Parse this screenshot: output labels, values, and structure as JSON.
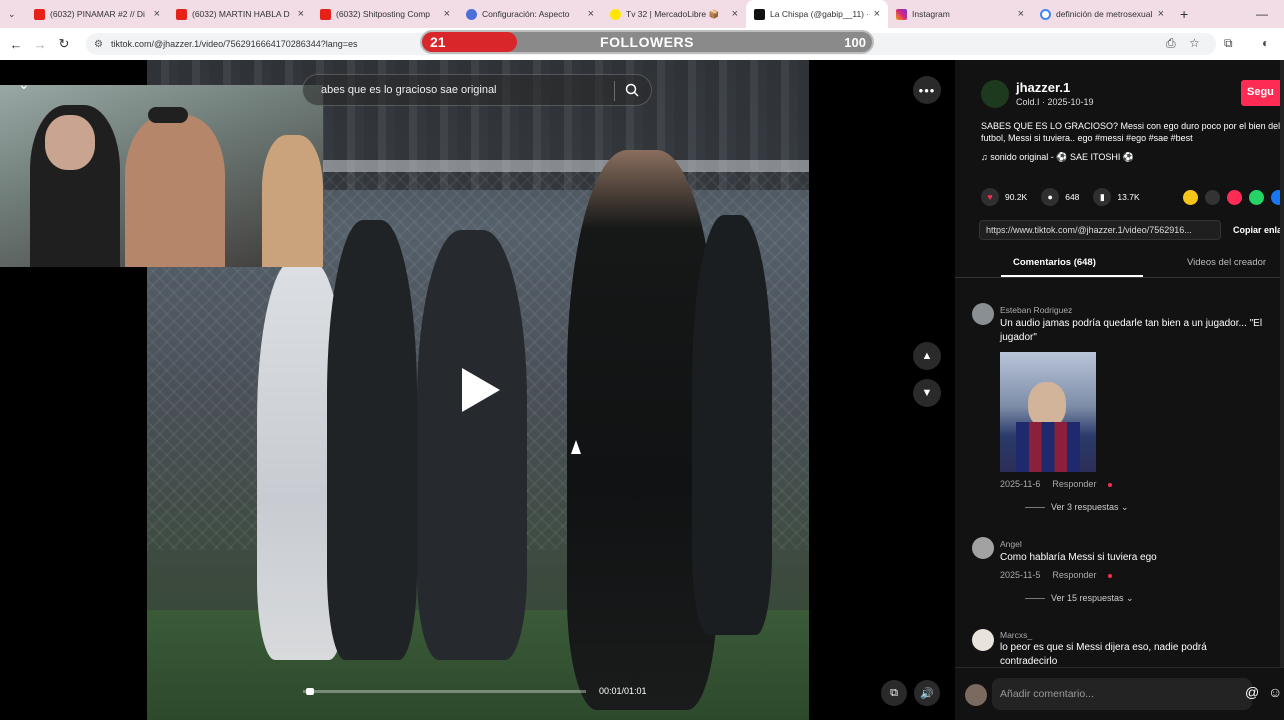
{
  "browser": {
    "tabs": [
      {
        "label": "(6032) PINAMAR #2 // Di",
        "favicon": "youtube",
        "active": false
      },
      {
        "label": "(6032) MARTIN HABLA D",
        "favicon": "youtube",
        "active": false
      },
      {
        "label": "(6032) Shitposting Comp",
        "favicon": "youtube",
        "active": false
      },
      {
        "label": "Configuración: Aspecto",
        "favicon": "gear",
        "active": false
      },
      {
        "label": "Tv 32 | MercadoLibre 📦",
        "favicon": "mercadolibre",
        "active": false
      },
      {
        "label": "La Chispa (@gabip__11) ·",
        "favicon": "tiktok",
        "active": true
      },
      {
        "label": "Instagram",
        "favicon": "instagram",
        "active": false
      },
      {
        "label": "definición de metrosexual",
        "favicon": "google",
        "active": false
      }
    ],
    "url": "tiktok.com/@jhazzer.1/video/7562916664170286344?lang=es"
  },
  "overlay": {
    "followers_label": "FOLLOWERS",
    "current": "21",
    "goal": "100",
    "progress_fraction": 0.21
  },
  "video": {
    "search_text": "abes que es lo gracioso sae original",
    "time": "00:01/01:01",
    "progress_fraction": 0.01
  },
  "creator": {
    "username": "jhazzer.1",
    "subline": "Cold.I · 2025-10-19",
    "follow_label": "Segu",
    "description": "SABES QUE ES LO GRACIOSO? Messi con ego duro poco por el bien del futbol, Messi si tuviera.. ego #messi #ego #sae #best",
    "music": "♫  sonido original - ⚽ SAE ITOSHI ⚽"
  },
  "stats": {
    "likes": "90.2K",
    "comments": "648",
    "saves": "13.7K"
  },
  "link": {
    "url": "https://www.tiktok.com/@jhazzer.1/video/7562916...",
    "copy_label": "Copiar enla"
  },
  "tabs": {
    "comments": "Comentarios (648)",
    "creator_videos": "Videos del creador"
  },
  "comments": [
    {
      "name": "Esteban Rodriguez",
      "text": "Un audio jamas podría quedarle tan bien a un jugador... \"El jugador\"",
      "date": "2025-11-6",
      "reply": "Responder",
      "replies": "Ver 3 respuestas ⌄"
    },
    {
      "name": "Angel",
      "text": "Como hablaría Messi si tuviera ego",
      "date": "2025-11-5",
      "reply": "Responder",
      "replies": "Ver 15 respuestas ⌄"
    },
    {
      "name": "Marcxs_",
      "text": "lo peor es que si Messi dijera eso, nadie podrá contradecirlo"
    }
  ],
  "input": {
    "placeholder": "Añadir comentario...",
    "at": "@"
  },
  "colors": {
    "tiktok_red": "#fe2c55",
    "followers_fill": "#d9262b",
    "panel_bg": "#121212",
    "tab_strip": "#f2dde6"
  }
}
